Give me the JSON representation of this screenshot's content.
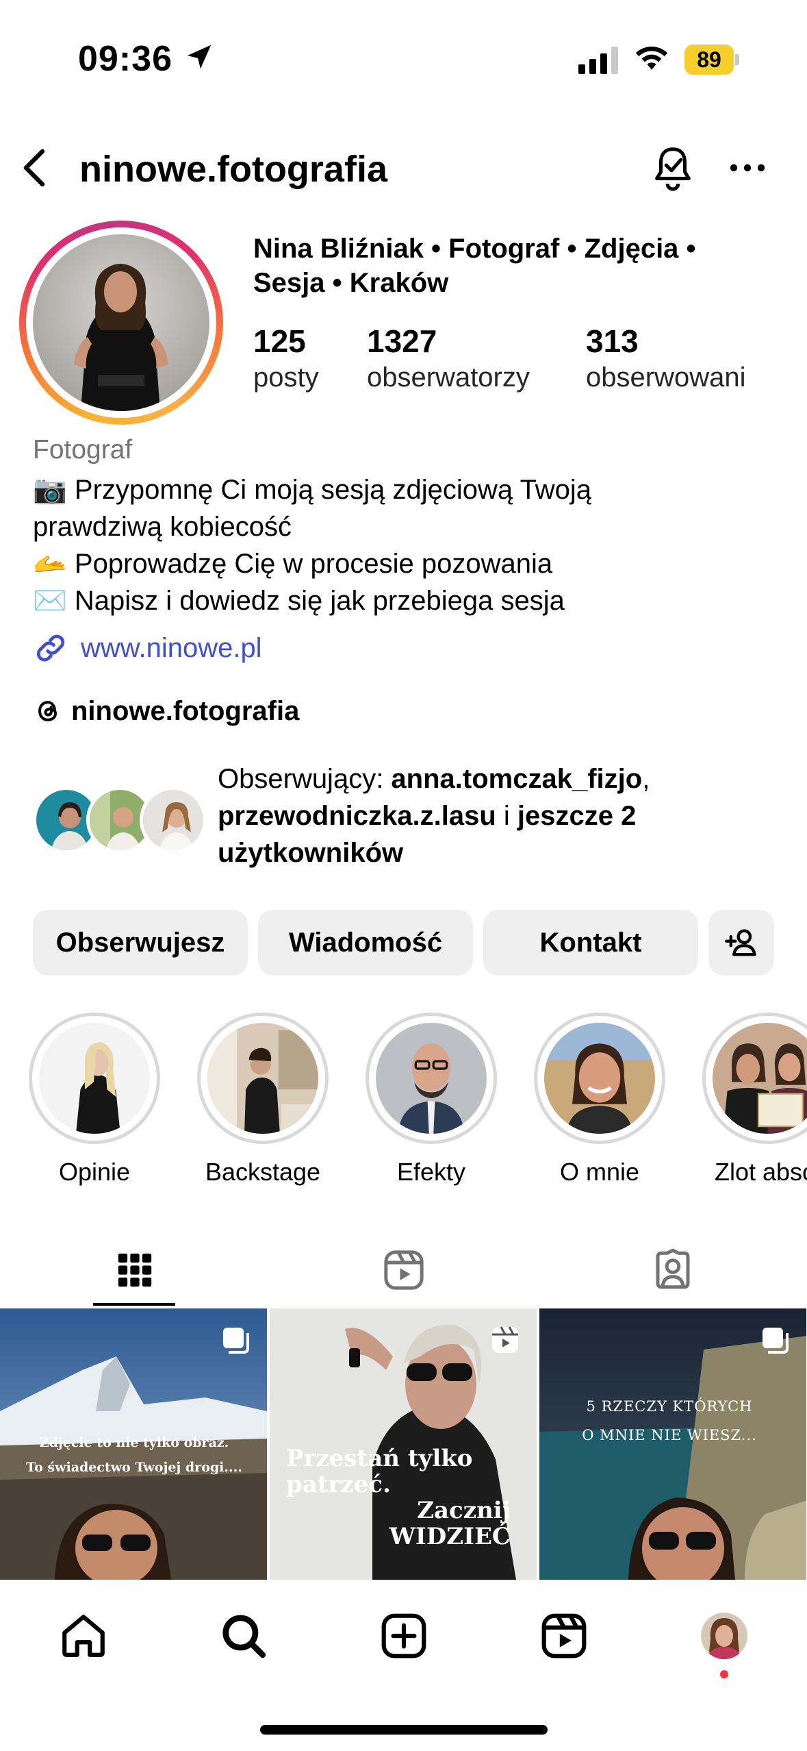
{
  "status_bar": {
    "time": "09:36",
    "battery": "89"
  },
  "header": {
    "username": "ninowe.fotografia"
  },
  "profile": {
    "full_name": "Nina Bliźniak • Fotograf • Zdjęcia • Sesja • Kraków",
    "stats": [
      {
        "value": "125",
        "label": "posty"
      },
      {
        "value": "1327",
        "label": "obserwatorzy"
      },
      {
        "value": "313",
        "label": "obserwowani"
      }
    ],
    "category": "Fotograf",
    "bio_lines": [
      "📷 Przypomnę Ci moją sesją zdjęciową Twoją",
      "prawdziwą kobiecość",
      "🫴 Poprowadzę Cię w procesie pozowania",
      "✉️ Napisz i dowiedz się jak przebiega sesja"
    ],
    "link": "www.ninowe.pl",
    "threads": "ninowe.fotografia"
  },
  "followed_by": {
    "prefix": "Obserwujący: ",
    "user1": "anna.tomczak_fizjo",
    "sep": ",",
    "user2": "przewodniczka.z.lasu",
    "mid": " i ",
    "rest": "jeszcze 2 użytkowników"
  },
  "buttons": {
    "follow": "Obserwujesz",
    "message": "Wiadomość",
    "contact": "Kontakt"
  },
  "highlights": [
    {
      "label": "Opinie"
    },
    {
      "label": "Backstage"
    },
    {
      "label": "Efekty"
    },
    {
      "label": "O mnie"
    },
    {
      "label": "Zlot absol"
    }
  ],
  "posts": [
    {
      "caption_line1": "Zdjęcie to nie tylko obraz.",
      "caption_line2": "To świadectwo Twojej drogi...."
    },
    {
      "caption_line1": "Przestań tylko",
      "caption_line2": "patrzeć.",
      "caption_line3": "Zacznij",
      "caption_line4": "WIDZIEĆ"
    },
    {
      "caption_line1": "5 RZECZY KTÓRYCH",
      "caption_line2": "O MNIE NIE WIESZ..."
    }
  ],
  "colors": {
    "link": "#4150c9",
    "button_bg": "#efefef",
    "battery": "#f6cf2c",
    "notification_dot": "#ff3040"
  }
}
